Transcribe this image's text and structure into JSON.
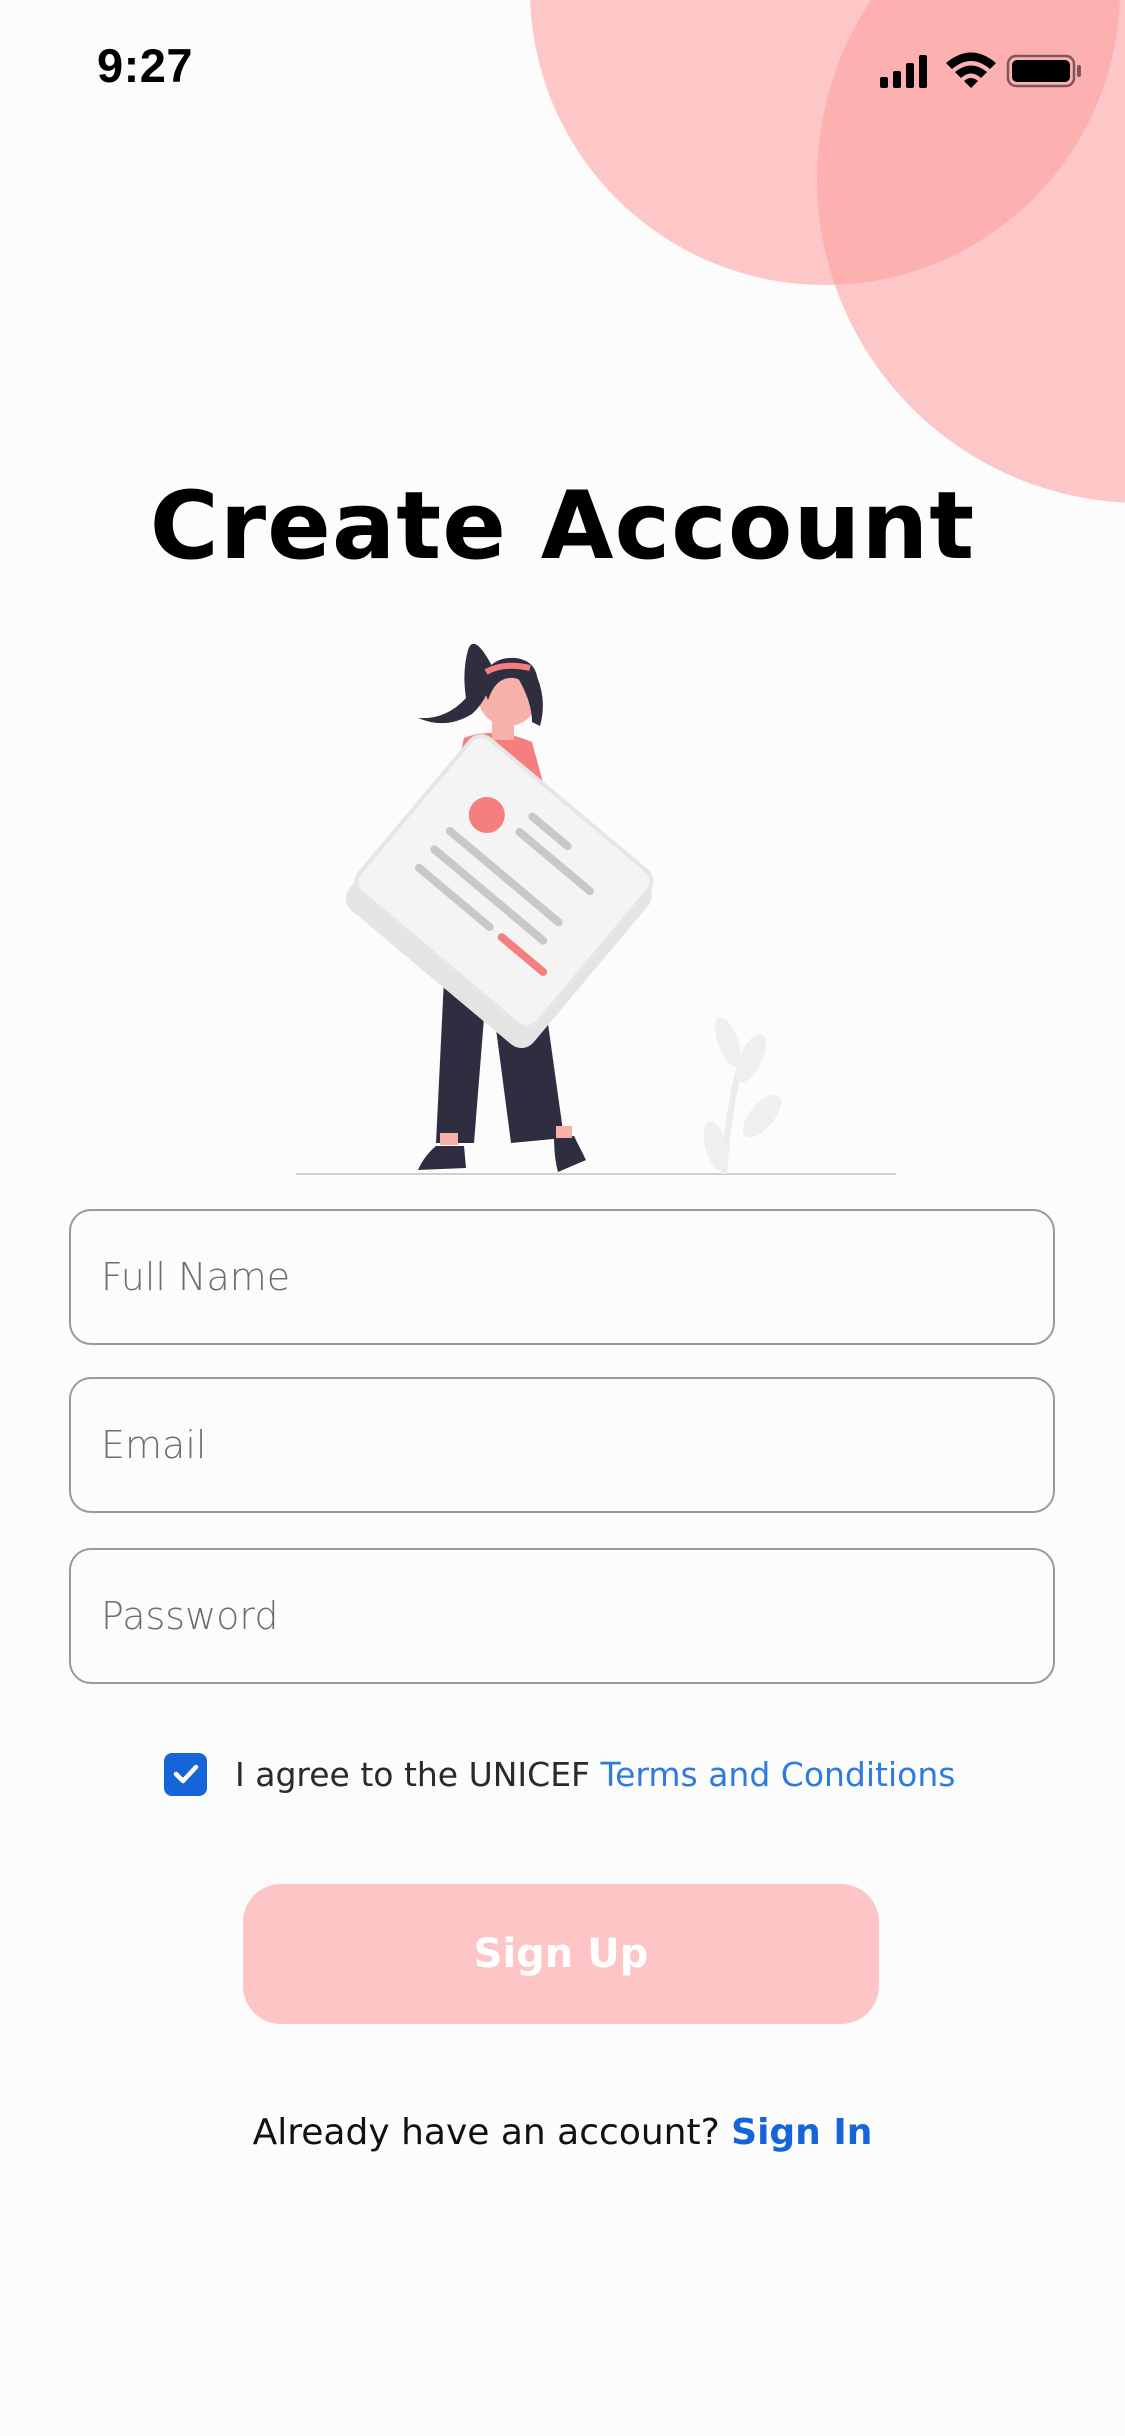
{
  "status_bar": {
    "time": "9:27",
    "icons": [
      "cellular-signal-icon",
      "wifi-icon",
      "battery-icon"
    ]
  },
  "title": "Create Account",
  "illustration": {
    "icon": "woman-holding-document-illustration"
  },
  "form": {
    "full_name": {
      "placeholder": "Full Name",
      "value": ""
    },
    "email": {
      "placeholder": "Email",
      "value": ""
    },
    "password": {
      "placeholder": "Password",
      "value": ""
    }
  },
  "terms": {
    "checked": true,
    "text": "I agree to the UNICEF ",
    "link_text": "Terms and Conditions"
  },
  "signup_button": {
    "label": "Sign Up",
    "enabled": false
  },
  "signin": {
    "prompt": "Already have an account? ",
    "link_text": "Sign In"
  },
  "colors": {
    "accent_blue": "#1565d8",
    "link_blue": "#2d7be0",
    "decor_pink": "#fda0a0",
    "button_disabled": "#fdc5c5",
    "figure_coral": "#f57f7f",
    "figure_dark": "#2f2e41"
  }
}
